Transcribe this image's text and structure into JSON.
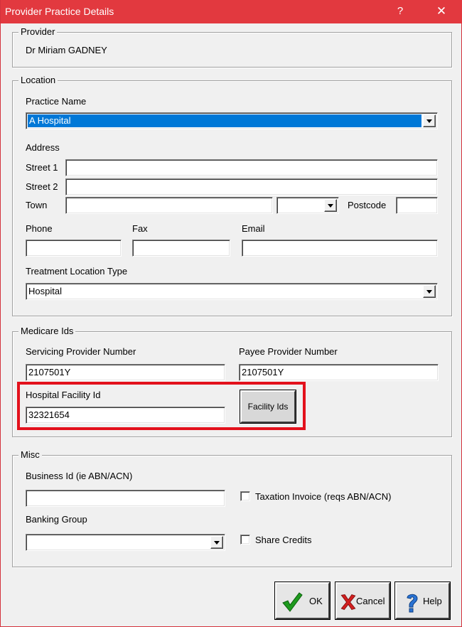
{
  "window": {
    "title": "Provider Practice Details",
    "help_glyph": "?",
    "close_glyph": "✕"
  },
  "provider": {
    "legend": "Provider",
    "name": "Dr Miriam GADNEY"
  },
  "location": {
    "legend": "Location",
    "practice_name_label": "Practice Name",
    "practice_name_value": "A Hospital",
    "address_label": "Address",
    "street1_label": "Street 1",
    "street1_value": "",
    "street2_label": "Street 2",
    "street2_value": "",
    "town_label": "Town",
    "town_value": "",
    "state_value": "",
    "postcode_label": "Postcode",
    "postcode_value": "",
    "phone_label": "Phone",
    "phone_value": "",
    "fax_label": "Fax",
    "fax_value": "",
    "email_label": "Email",
    "email_value": "",
    "treatment_type_label": "Treatment Location Type",
    "treatment_type_value": "Hospital"
  },
  "medicare": {
    "legend": "Medicare Ids",
    "servicing_label": "Servicing Provider Number",
    "servicing_value": "2107501Y",
    "payee_label": "Payee Provider Number",
    "payee_value": "2107501Y",
    "hospital_facility_label": "Hospital Facility Id",
    "hospital_facility_value": "32321654",
    "facility_ids_button": "Facility Ids"
  },
  "misc": {
    "legend": "Misc",
    "business_id_label": "Business Id (ie ABN/ACN)",
    "business_id_value": "",
    "taxation_invoice_label": "Taxation Invoice (reqs ABN/ACN)",
    "taxation_invoice_checked": false,
    "banking_group_label": "Banking Group",
    "banking_group_value": "",
    "share_credits_label": "Share Credits",
    "share_credits_checked": false
  },
  "buttons": {
    "ok": "OK",
    "cancel": "Cancel",
    "help": "Help"
  },
  "colors": {
    "titlebar": "#e2393f",
    "highlight": "#e3111c",
    "selection": "#0078d7"
  }
}
